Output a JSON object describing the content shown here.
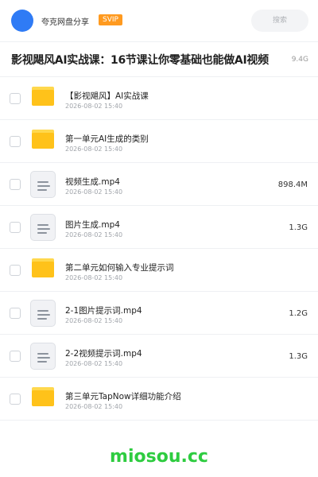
{
  "header": {
    "app_name": "夸克网盘分享",
    "badge": "SVIP",
    "search_placeholder": "搜索",
    "avatar_color": "#2f7bf5"
  },
  "share": {
    "title": "影视飓风AI实战课：16节课让你零基础也能做AI视频",
    "total_size": "9.4G"
  },
  "files": [
    {
      "type": "folder",
      "icon": "folder-icon",
      "name": "【影视飓风】AI实战课",
      "date": "2026-08-02 15:40",
      "size": ""
    },
    {
      "type": "folder",
      "icon": "folder-icon",
      "name": "第一单元AI生成的类别",
      "date": "2026-08-02 15:40",
      "size": ""
    },
    {
      "type": "file",
      "icon": "document-icon",
      "name": "视频生成.mp4",
      "date": "2026-08-02 15:40",
      "size": "898.4M"
    },
    {
      "type": "file",
      "icon": "document-icon",
      "name": "图片生成.mp4",
      "date": "2026-08-02 15:40",
      "size": "1.3G"
    },
    {
      "type": "folder",
      "icon": "folder-icon",
      "name": "第二单元如何输入专业提示词",
      "date": "2026-08-02 15:40",
      "size": ""
    },
    {
      "type": "file",
      "icon": "document-icon",
      "name": "2-1图片提示词.mp4",
      "date": "2026-08-02 15:40",
      "size": "1.2G"
    },
    {
      "type": "file",
      "icon": "document-icon",
      "name": "2-2视频提示词.mp4",
      "date": "2026-08-02 15:40",
      "size": "1.3G"
    },
    {
      "type": "folder",
      "icon": "folder-icon",
      "name": "第三单元TapNow详细功能介绍",
      "date": "2026-08-02 15:40",
      "size": ""
    }
  ],
  "watermark": "miosou.cc",
  "colors": {
    "folder": "#ffc21a",
    "badge": "#ff9a1f",
    "watermark": "#2ecc40"
  }
}
